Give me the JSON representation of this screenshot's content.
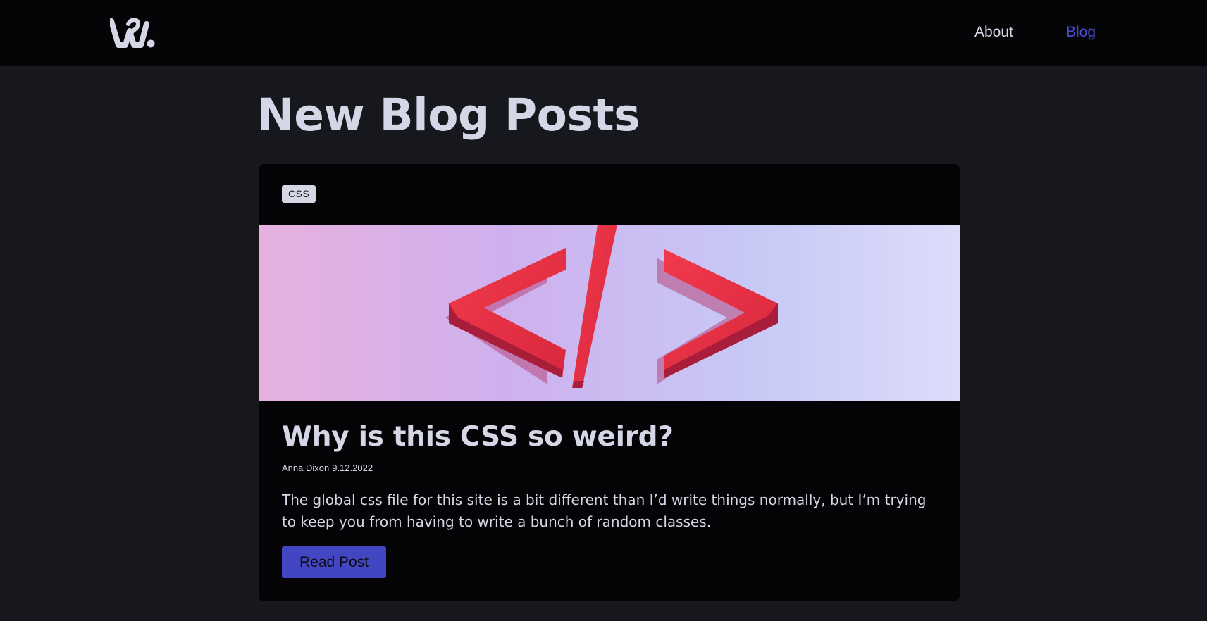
{
  "header": {
    "logo_alt": "W.",
    "nav": [
      {
        "label": "About",
        "active": false
      },
      {
        "label": "Blog",
        "active": true
      }
    ],
    "active_color": "#4a4cd6"
  },
  "main": {
    "title": "New Blog Posts",
    "posts": [
      {
        "tag": "CSS",
        "image_icon": "code-brackets-image",
        "title": "Why is this CSS so weird?",
        "author": "Anna Dixon",
        "date": "9.12.2022",
        "excerpt": "The global css file for this site is a bit different than I’d write things normally, but I’m trying to keep you from having to write a bunch of random classes.",
        "button_label": "Read Post"
      }
    ]
  },
  "colors": {
    "page_bg": "#17181d",
    "header_bg": "#050507",
    "card_bg": "#040406",
    "text": "#d6d7e6",
    "button_bg": "#4346c3"
  }
}
